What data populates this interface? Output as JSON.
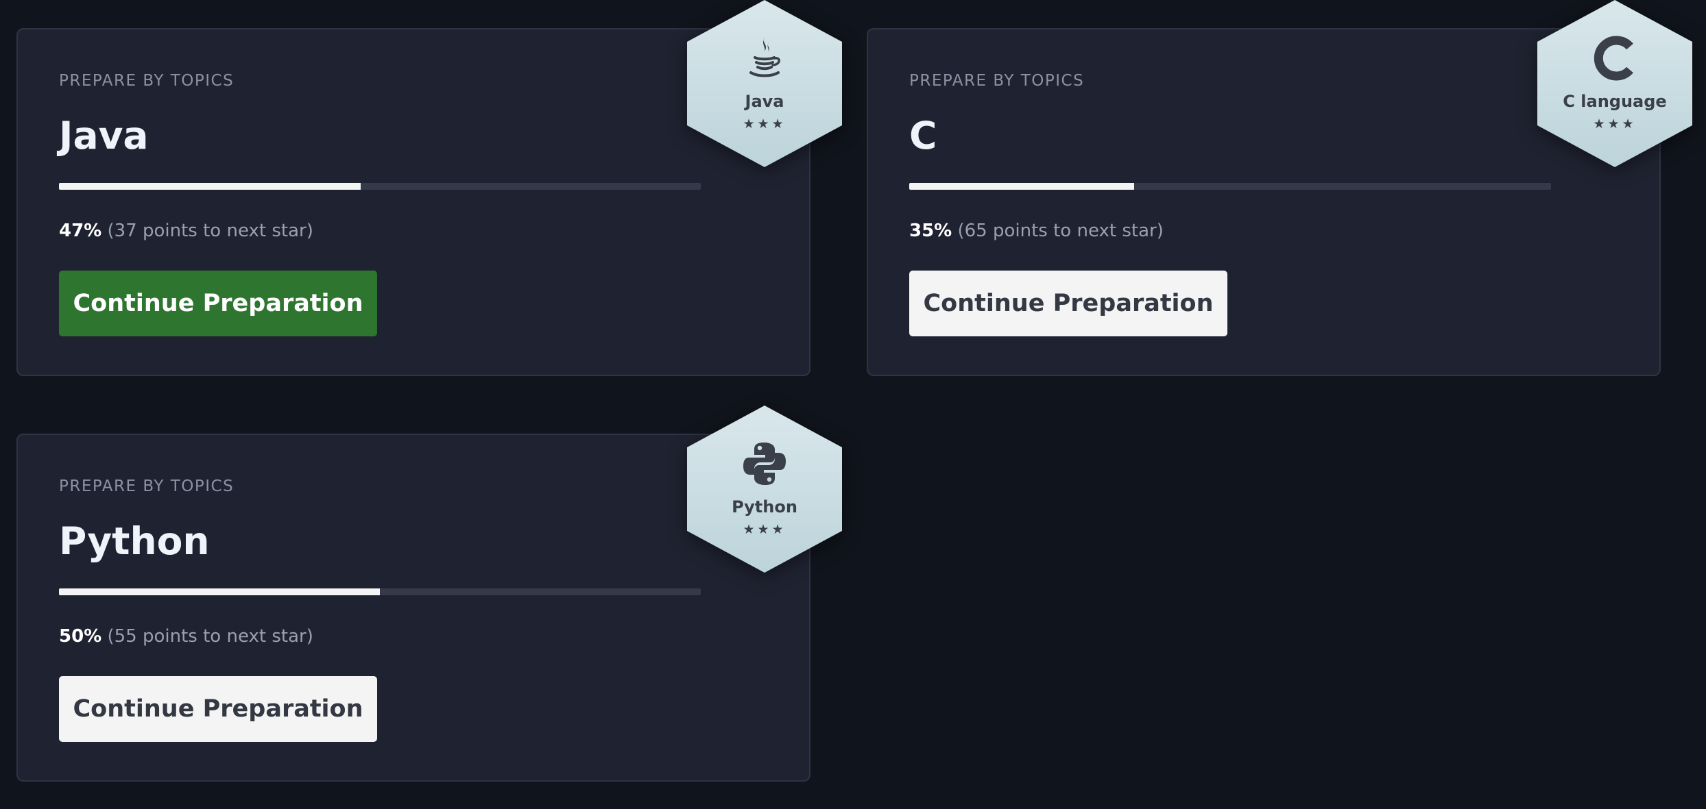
{
  "cards": [
    {
      "eyebrow": "PREPARE BY TOPICS",
      "title": "Java",
      "progress_percent": 47,
      "percent_text": "47%",
      "points_text": "(37 points to next star)",
      "button_label": "Continue Preparation",
      "button_style": "primary",
      "badge": {
        "label": "Java",
        "icon": "java-cup-icon",
        "stars": "★★★"
      }
    },
    {
      "eyebrow": "PREPARE BY TOPICS",
      "title": "C",
      "progress_percent": 35,
      "percent_text": "35%",
      "points_text": "(65 points to next star)",
      "button_label": "Continue Preparation",
      "button_style": "secondary",
      "badge": {
        "label": "C language",
        "icon": "c-letter-icon",
        "stars": "★★★"
      }
    },
    {
      "eyebrow": "PREPARE BY TOPICS",
      "title": "Python",
      "progress_percent": 50,
      "percent_text": "50%",
      "points_text": "(55 points to next star)",
      "button_label": "Continue Preparation",
      "button_style": "secondary",
      "badge": {
        "label": "Python",
        "icon": "python-logo-icon",
        "stars": "★★★"
      }
    }
  ],
  "colors": {
    "background": "#10141c",
    "card": "#1f2331",
    "primary_button": "#2e7630",
    "secondary_button": "#f4f4f5",
    "progress_fill": "#f4f4f4",
    "progress_track": "#353a4a",
    "badge": "#cfe0e5"
  }
}
